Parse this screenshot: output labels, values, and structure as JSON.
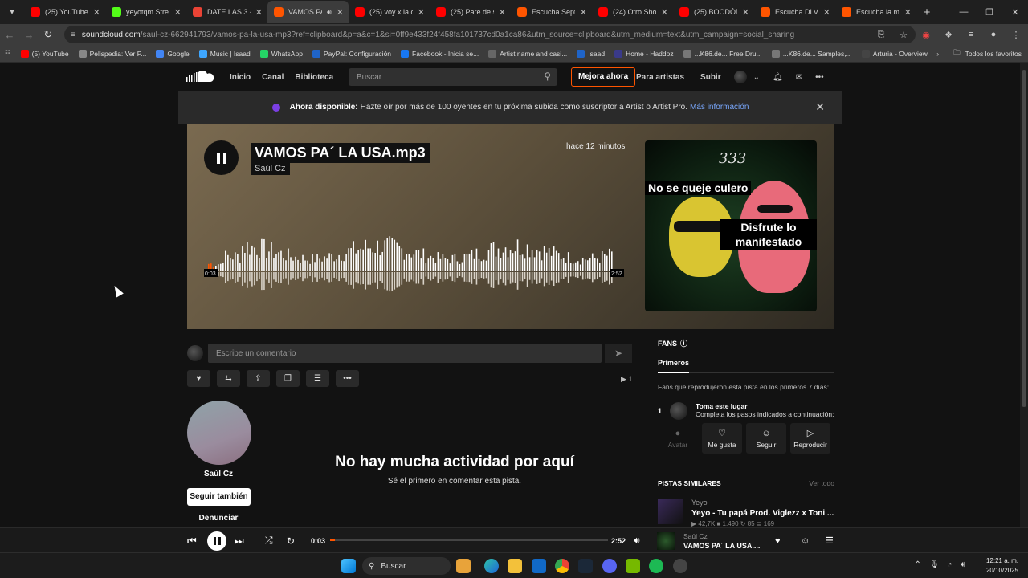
{
  "browser": {
    "tabs": [
      {
        "title": "(25) YouTube",
        "color": "#ff0000"
      },
      {
        "title": "yeyotqm Stream",
        "color": "#53fc18"
      },
      {
        "title": "DATE LAS 3 - de",
        "color": "#ea4335"
      },
      {
        "title": "VAMOS PA´ LA",
        "color": "#ff5500",
        "active": true
      },
      {
        "title": "(25) voy x la ca",
        "color": "#ff0000"
      },
      {
        "title": "(25) Pare de su",
        "color": "#ff0000"
      },
      {
        "title": "Escucha Sept 2",
        "color": "#ff5500"
      },
      {
        "title": "(24) Otro Shot",
        "color": "#ff0000"
      },
      {
        "title": "(25) BOODÓN",
        "color": "#ff0000"
      },
      {
        "title": "Escucha DLV d",
        "color": "#ff5500"
      },
      {
        "title": "Escucha la mús",
        "color": "#ff5500"
      }
    ],
    "new_tab": "+",
    "url_main": "soundcloud.com",
    "url_rest": "/saul-cz-662941793/vamos-pa-la-usa-mp3?ref=clipboard&p=a&c=1&si=0ff9e433f24f458fa101737cd0a1ca86&utm_source=clipboard&utm_medium=text&utm_campaign=social_sharing",
    "bookmarks": [
      {
        "label": "(5) YouTube",
        "color": "#ff0000"
      },
      {
        "label": "Pelispedia: Ver P...",
        "color": "#888888"
      },
      {
        "label": "Google",
        "color": "#4285f4"
      },
      {
        "label": "Music | Isaad",
        "color": "#3ea6ff"
      },
      {
        "label": "WhatsApp",
        "color": "#25d366"
      },
      {
        "label": "PayPal: Configuración",
        "color": "#1f64c8"
      },
      {
        "label": "Facebook - Inicia se...",
        "color": "#1877f2"
      },
      {
        "label": "Artist name and casi...",
        "color": "#666666"
      },
      {
        "label": "Isaad",
        "color": "#1f64c8"
      },
      {
        "label": "Home - Haddoz",
        "color": "#3a3a8a"
      },
      {
        "label": "...K86.de... Free Dru...",
        "color": "#777777"
      },
      {
        "label": "...K86.de... Samples,...",
        "color": "#777777"
      },
      {
        "label": "Arturia - Overview",
        "color": "#444444"
      }
    ],
    "bookmarks_all": "Todos los favoritos"
  },
  "header": {
    "nav": [
      "Inicio",
      "Canal",
      "Biblioteca"
    ],
    "search_placeholder": "Buscar",
    "upgrade": "Mejora ahora",
    "for_artists": "Para artistas",
    "upload": "Subir"
  },
  "banner": {
    "bold": "Ahora disponible:",
    "text": "Hazte oír por más de 100 oyentes en tu próxima subida como suscriptor a Artist o Artist Pro.",
    "link": "Más información"
  },
  "track": {
    "title": "VAMOS PA´ LA USA.mp3",
    "artist": "Saúl Cz",
    "posted": "hace 12 minutos",
    "time_current": "0:03",
    "time_total": "2:52",
    "progress": 0.017,
    "cover_number": "333",
    "cover_caption_1": "No se queje culero",
    "cover_caption_2": "Disfrute lo manifestado"
  },
  "comment": {
    "placeholder": "Escribe un comentario"
  },
  "plays": "1",
  "artist_panel": {
    "name": "Saúl Cz",
    "follow": "Seguir también",
    "report": "Denunciar"
  },
  "empty": {
    "title": "No hay mucha actividad por aquí",
    "subtitle": "Sé el primero en comentar esta pista."
  },
  "fans": {
    "heading": "FANS",
    "tab": "Primeros",
    "description": "Fans que reprodujeron esta pista en los primeros 7 días:",
    "rank": "1",
    "place_title": "Toma este lugar",
    "place_text": "Completa los pasos indicados a continuación:",
    "buttons": [
      "Avatar",
      "Me gusta",
      "Seguir",
      "Reproducir"
    ]
  },
  "similar": {
    "heading": "PISTAS SIMILARES",
    "see_all": "Ver todo",
    "artist": "Yeyo",
    "title": "Yeyo - Tu papá Prod. Viglezz x Toni ...",
    "stats": "▶ 42,7K  ■ 1.490  ↻ 85  ≣ 169"
  },
  "player": {
    "current": "0:03",
    "total": "2:52",
    "artist": "Saúl Cz",
    "title": "VAMOS PA´ LA USA...."
  },
  "taskbar": {
    "search": "Buscar",
    "time": "12:21 a. m.",
    "date": "20/10/2025"
  }
}
